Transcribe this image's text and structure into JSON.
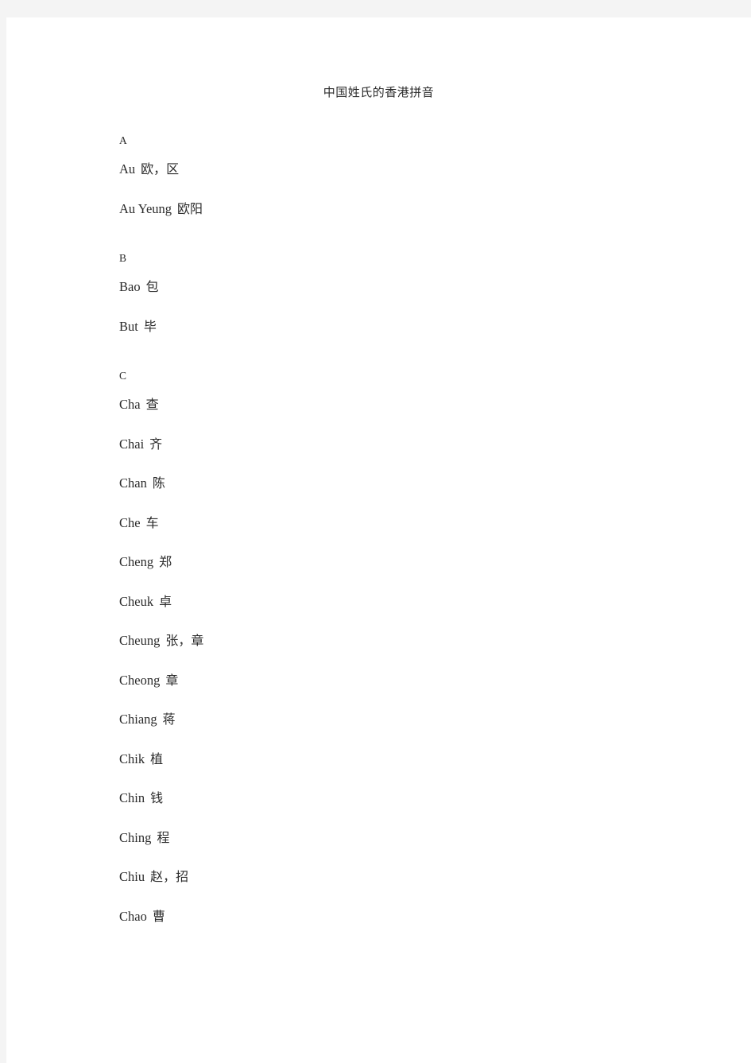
{
  "document": {
    "title": "中国姓氏的香港拼音",
    "sections": [
      {
        "letter": "A",
        "entries": [
          {
            "roman": "Au",
            "chinese": "欧，区"
          },
          {
            "roman": "Au Yeung",
            "chinese": "欧阳"
          }
        ]
      },
      {
        "letter": "B",
        "entries": [
          {
            "roman": "Bao",
            "chinese": "包"
          },
          {
            "roman": "But",
            "chinese": "毕"
          }
        ]
      },
      {
        "letter": "C",
        "entries": [
          {
            "roman": "Cha",
            "chinese": "查"
          },
          {
            "roman": "Chai",
            "chinese": "齐"
          },
          {
            "roman": "Chan",
            "chinese": "陈"
          },
          {
            "roman": "Che",
            "chinese": "车"
          },
          {
            "roman": "Cheng",
            "chinese": "郑"
          },
          {
            "roman": "Cheuk",
            "chinese": "卓"
          },
          {
            "roman": "Cheung",
            "chinese": "张，章"
          },
          {
            "roman": "Cheong",
            "chinese": "章"
          },
          {
            "roman": "Chiang",
            "chinese": "蒋"
          },
          {
            "roman": "Chik",
            "chinese": "植"
          },
          {
            "roman": "Chin",
            "chinese": "钱"
          },
          {
            "roman": "Ching",
            "chinese": "程"
          },
          {
            "roman": "Chiu",
            "chinese": "赵，招"
          },
          {
            "roman": "Chao",
            "chinese": "曹"
          }
        ]
      }
    ]
  },
  "colors": {
    "page_background": "#ffffff",
    "canvas_background": "#f4f4f4",
    "text": "#2b2b2b"
  }
}
